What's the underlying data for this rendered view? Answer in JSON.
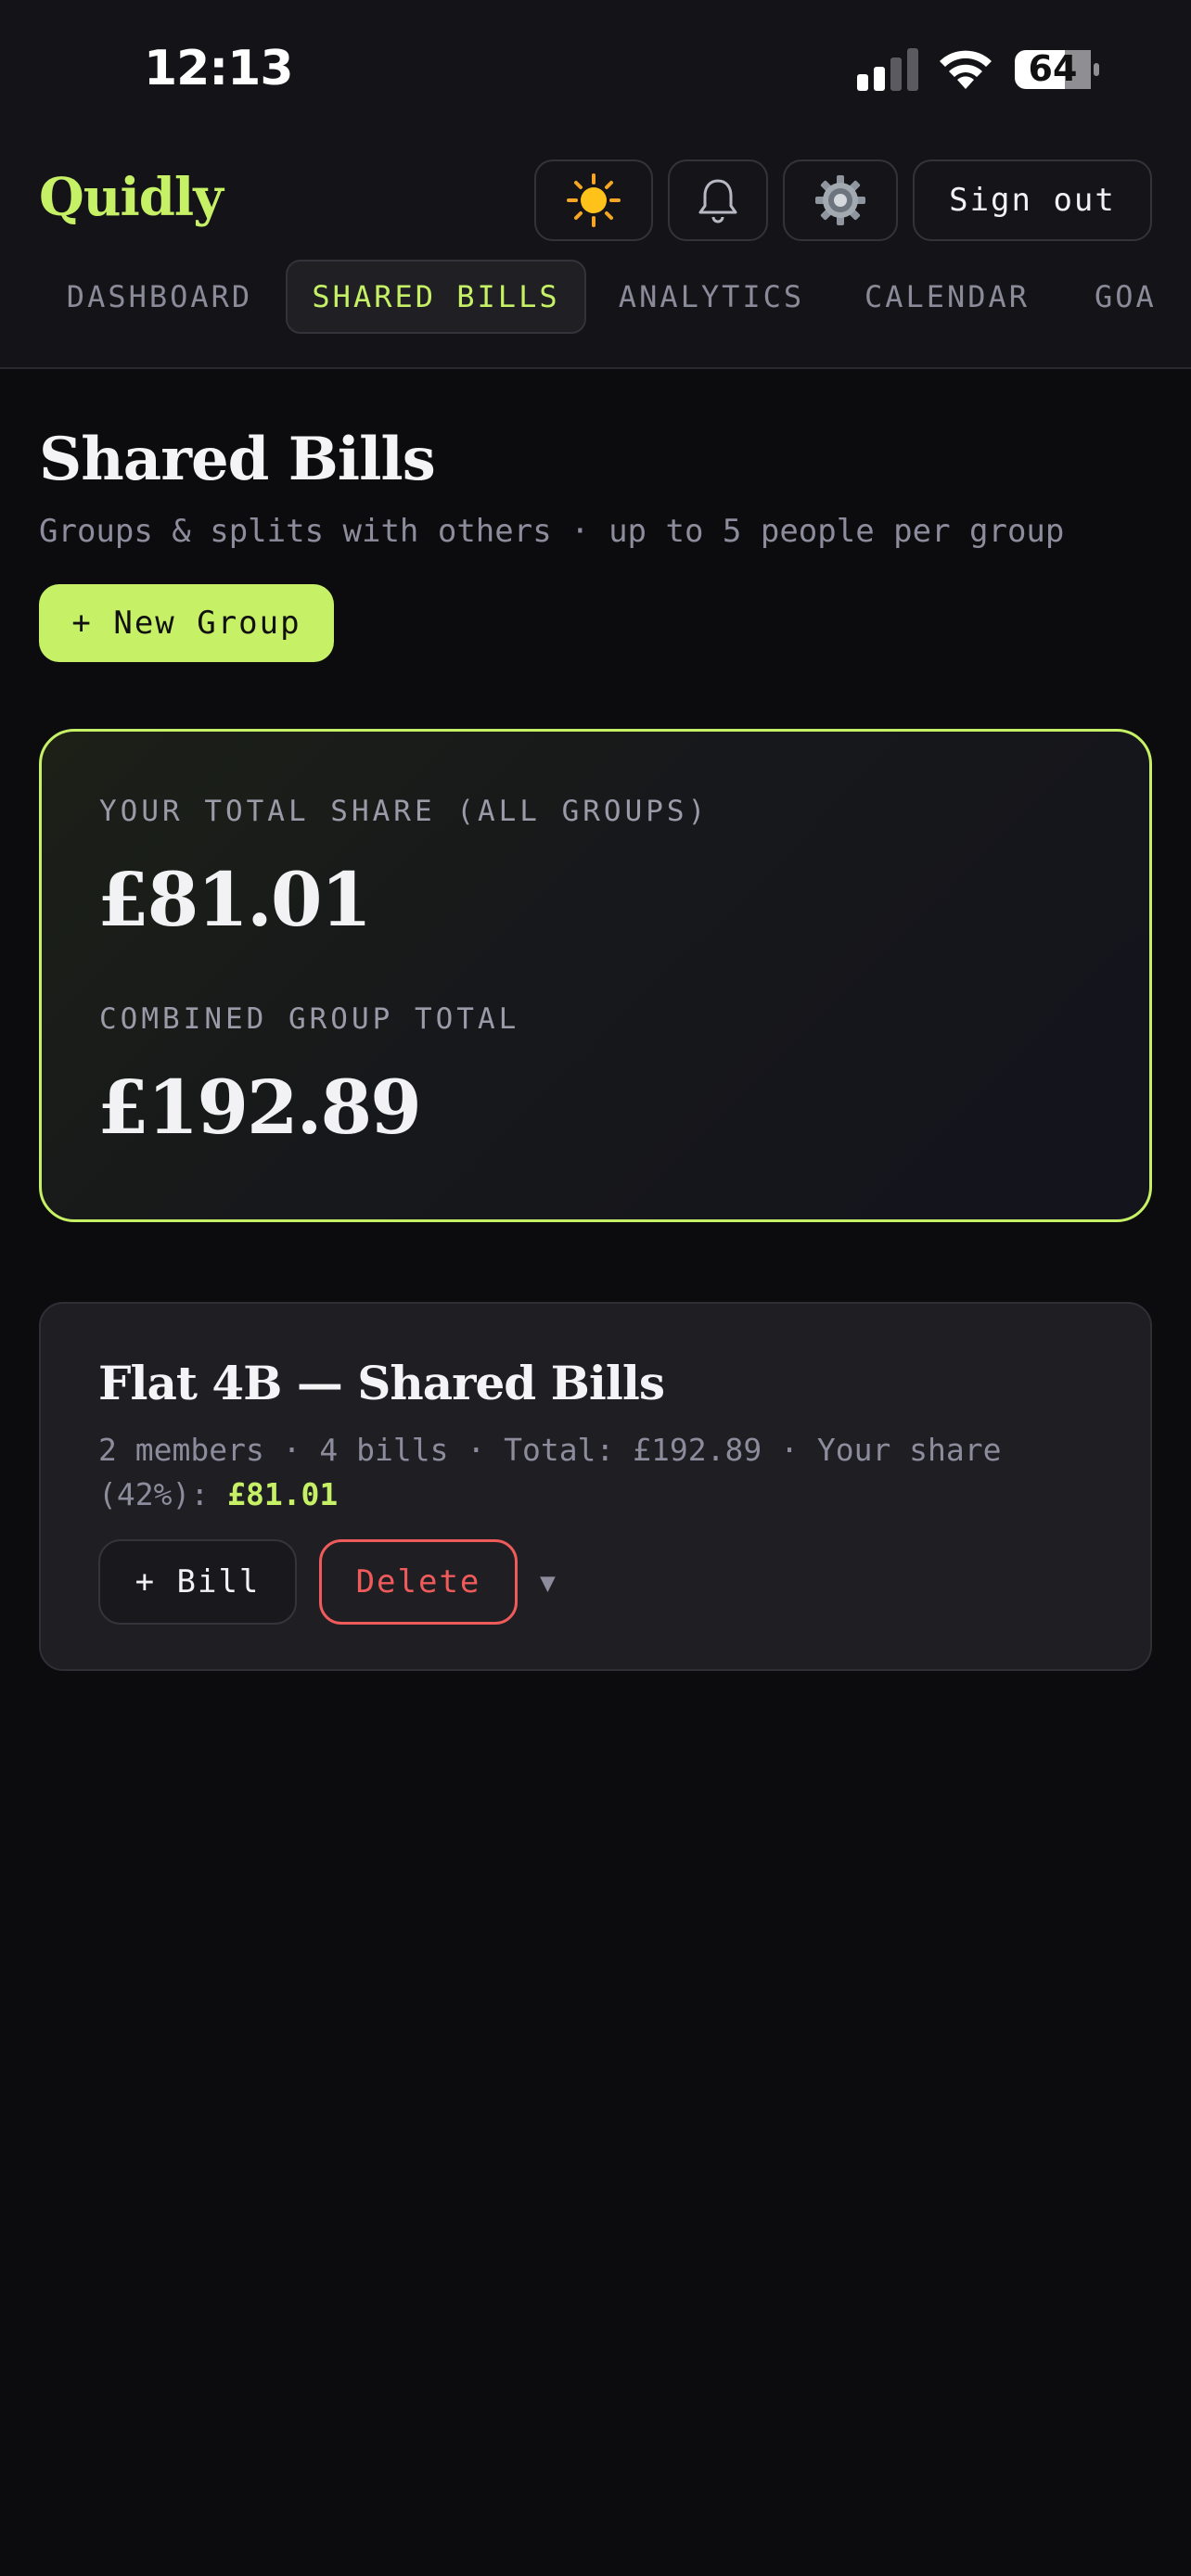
{
  "status_bar": {
    "time": "12:13",
    "battery": "64"
  },
  "header": {
    "brand": "Quidly",
    "signout_label": "Sign out",
    "icons": [
      "sun-icon",
      "bell-icon",
      "gear-icon"
    ]
  },
  "nav": {
    "tabs": [
      {
        "label": "DASHBOARD",
        "active": false
      },
      {
        "label": "SHARED BILLS",
        "active": true
      },
      {
        "label": "ANALYTICS",
        "active": false
      },
      {
        "label": "CALENDAR",
        "active": false
      },
      {
        "label": "GOA",
        "active": false
      }
    ]
  },
  "page": {
    "title": "Shared Bills",
    "subtitle": "Groups & splits with others · up to 5 people per group",
    "new_group_label": "+ New Group"
  },
  "summary": {
    "share_label": "YOUR TOTAL SHARE (ALL GROUPS)",
    "share_value": "£81.01",
    "combined_label": "COMBINED GROUP TOTAL",
    "combined_value": "£192.89"
  },
  "groups": [
    {
      "title": "Flat 4B — Shared Bills",
      "meta": "2 members · 4 bills · Total: £192.89 · Your share (42%): ",
      "share": "£81.01",
      "add_bill_label": "+ Bill",
      "delete_label": "Delete",
      "expand_glyph": "▼"
    }
  ],
  "colors": {
    "accent": "#c6f065",
    "danger": "#ef5a5a",
    "background": "#0c0c0e",
    "muted": "#8c8c9c"
  }
}
